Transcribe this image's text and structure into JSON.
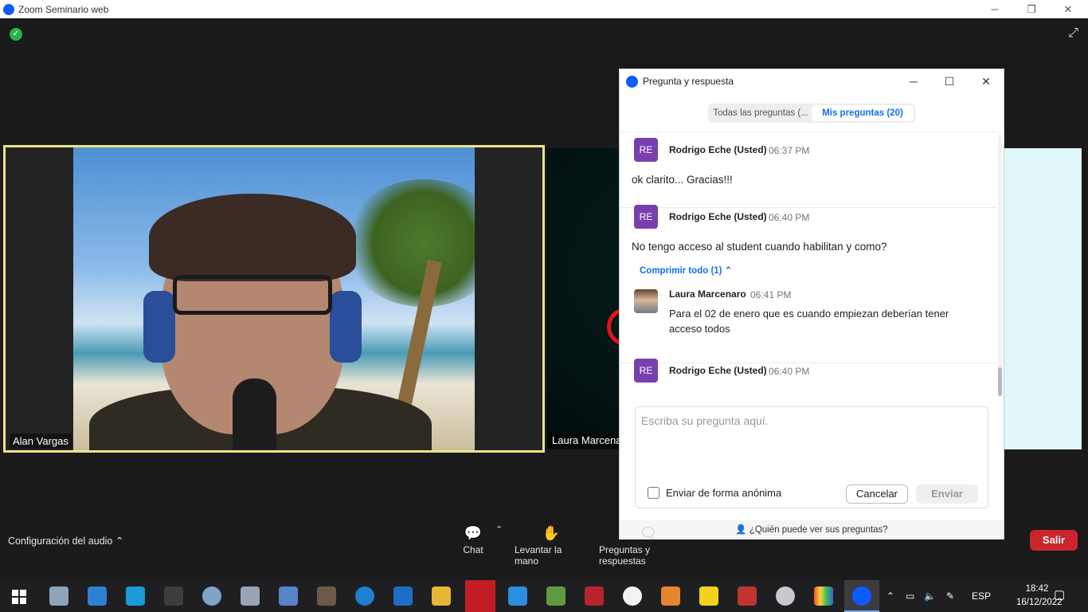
{
  "window": {
    "title": "Zoom Seminario web"
  },
  "tiles": {
    "main_name": "Alan Vargas",
    "second_name": "Laura Marcena"
  },
  "qa": {
    "title": "Pregunta y respuesta",
    "tabs": [
      "Todas las preguntas (...",
      "Mis preguntas (20)"
    ],
    "questions": [
      {
        "initials": "RE",
        "author": "Rodrigo Eche (Usted)",
        "time": "06:37 PM",
        "text": "ok clarito... Gracias!!!"
      },
      {
        "initials": "RE",
        "author": "Rodrigo Eche (Usted)",
        "time": "06:40 PM",
        "text": "No tengo acceso al student cuando habilitan y como?",
        "collapse_label": "Comprimir todo (1)",
        "reply": {
          "author": "Laura Marcenaro",
          "time": "06:41 PM",
          "text": "Para el 02 de enero que es cuando empiezan deberían tener acceso todos"
        }
      },
      {
        "initials": "RE",
        "author": "Rodrigo Eche (Usted)",
        "time": "06:40 PM"
      }
    ],
    "input_placeholder": "Escriba su pregunta aquí.",
    "anonymous_label": "Enviar de forma anónima",
    "cancel_label": "Cancelar",
    "send_label": "Enviar",
    "footer": "¿Quién puede ver sus preguntas?"
  },
  "controls": {
    "audio_label": "Configuración del audio",
    "chat": "Chat",
    "raise_hand": "Levantar la mano",
    "qa": "Preguntas y respuestas",
    "leave": "Salir"
  },
  "taskbar": {
    "lang": "ESP",
    "time": "18:42",
    "date": "16/12/2022"
  },
  "colors": {
    "accent": "#0e71eb",
    "leave": "#c9252d",
    "avatar": "#7a3fae",
    "speaker_border": "#e7e58a"
  }
}
